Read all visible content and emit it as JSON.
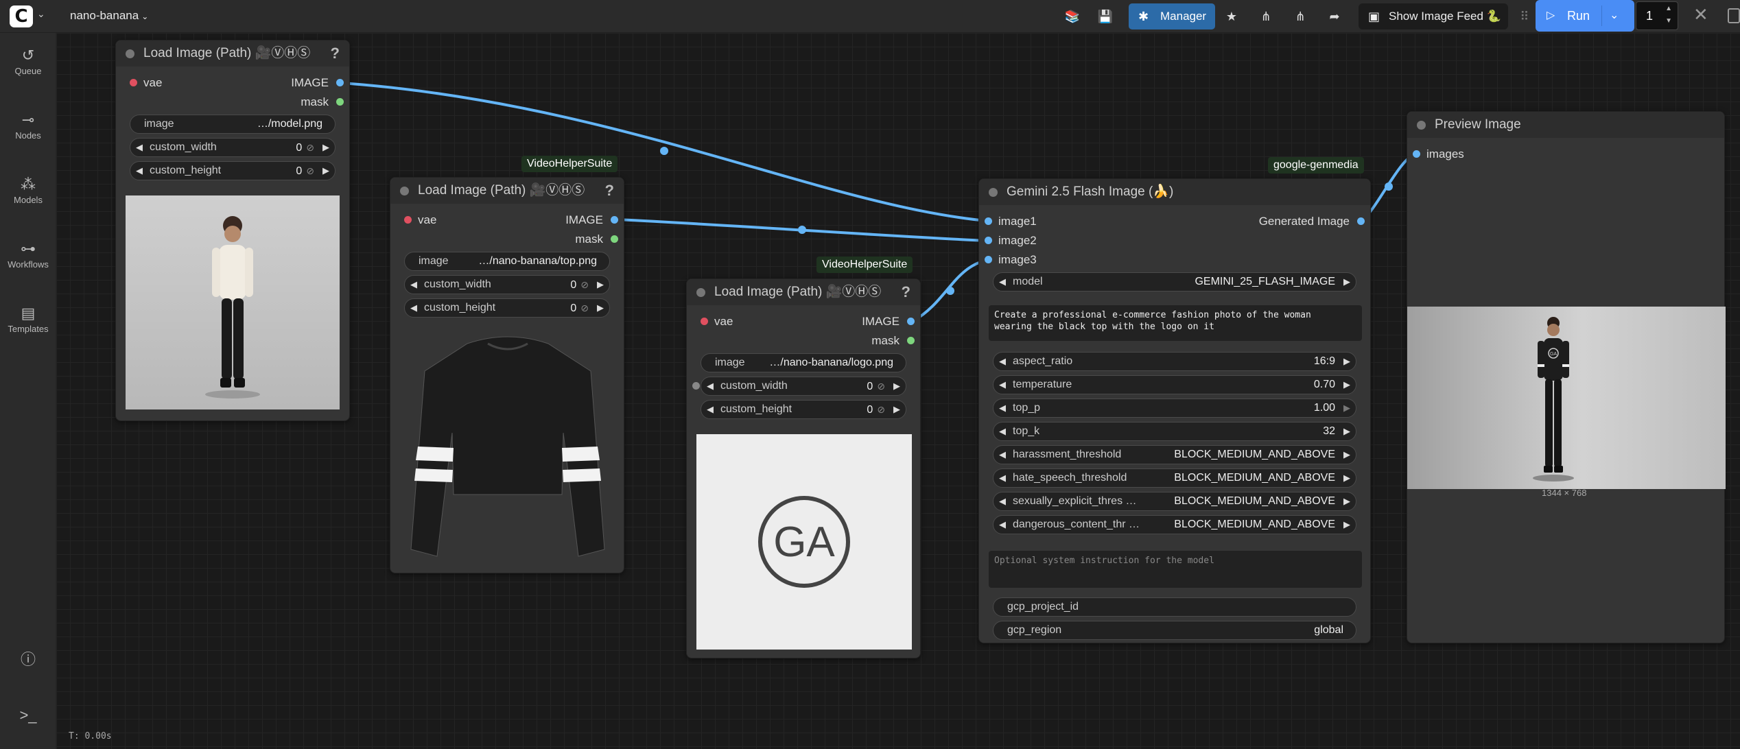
{
  "topbar": {
    "workflow_name": "nano-banana",
    "manager_label": "Manager",
    "feed_label": "Show Image Feed 🐍",
    "run_label": "Run",
    "run_count": "1"
  },
  "sidebar": {
    "items": [
      {
        "label": "Queue",
        "icon": "history-icon"
      },
      {
        "label": "Nodes",
        "icon": "node-icon"
      },
      {
        "label": "Models",
        "icon": "models-icon"
      },
      {
        "label": "Workflows",
        "icon": "workflow-icon"
      },
      {
        "label": "Templates",
        "icon": "templates-icon"
      }
    ]
  },
  "canvas_stats": "T: 0.00s",
  "nodes": {
    "load1": {
      "title": "Load Image (Path) 🎥ⓋⒽⓈ",
      "input_vae": "vae",
      "out_image": "IMAGE",
      "out_mask": "mask",
      "image_label": "image",
      "image_value": "…/model.png",
      "w_label": "custom_width",
      "w_value": "0",
      "h_label": "custom_height",
      "h_value": "0"
    },
    "load2": {
      "badge": "VideoHelperSuite",
      "title": "Load Image (Path) 🎥ⓋⒽⓈ",
      "input_vae": "vae",
      "out_image": "IMAGE",
      "out_mask": "mask",
      "image_label": "image",
      "image_value": "…/nano-banana/top.png",
      "w_label": "custom_width",
      "w_value": "0",
      "h_label": "custom_height",
      "h_value": "0"
    },
    "load3": {
      "badge": "VideoHelperSuite",
      "title": "Load Image (Path) 🎥ⓋⒽⓈ",
      "input_vae": "vae",
      "out_image": "IMAGE",
      "out_mask": "mask",
      "image_label": "image",
      "image_value": "…/nano-banana/logo.png",
      "w_label": "custom_width",
      "w_value": "0",
      "h_label": "custom_height",
      "h_value": "0",
      "logo_text": "GA"
    },
    "gemini": {
      "badge": "google-genmedia",
      "title": "Gemini 2.5 Flash Image (🍌)",
      "in1": "image1",
      "in2": "image2",
      "in3": "image3",
      "output": "Generated Image",
      "model_label": "model",
      "model_value": "GEMINI_25_FLASH_IMAGE",
      "prompt": "Create a professional e-commerce fashion photo of the woman\nwearing the black top with the logo on it",
      "params": [
        {
          "label": "aspect_ratio",
          "value": "16:9"
        },
        {
          "label": "temperature",
          "value": "0.70"
        },
        {
          "label": "top_p",
          "value": "1.00"
        },
        {
          "label": "top_k",
          "value": "32"
        },
        {
          "label": "harassment_threshold",
          "value": "BLOCK_MEDIUM_AND_ABOVE"
        },
        {
          "label": "hate_speech_threshold",
          "value": "BLOCK_MEDIUM_AND_ABOVE"
        },
        {
          "label": "sexually_explicit_thres …",
          "value": "BLOCK_MEDIUM_AND_ABOVE"
        },
        {
          "label": "dangerous_content_thr …",
          "value": "BLOCK_MEDIUM_AND_ABOVE"
        }
      ],
      "system_placeholder": "Optional system instruction for the model",
      "project_label": "gcp_project_id",
      "project_value": "",
      "region_label": "gcp_region",
      "region_value": "global"
    },
    "preview": {
      "title": "Preview Image",
      "input": "images",
      "size_caption": "1344 × 768",
      "logo_text": "GA"
    }
  },
  "colors": {
    "wire": "#64b5f6",
    "run": "#4a8df5",
    "manager": "#2c6ba8"
  }
}
